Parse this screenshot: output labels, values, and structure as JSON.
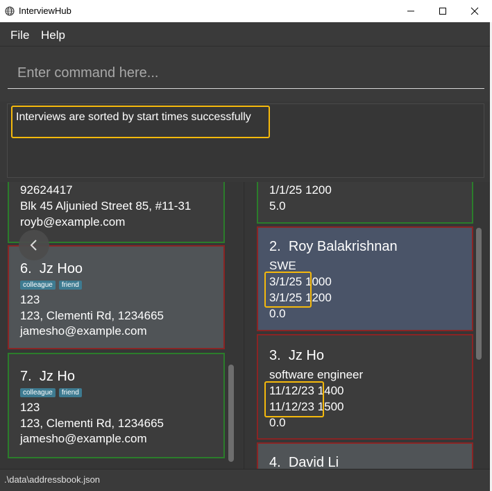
{
  "window": {
    "title": "InterviewHub"
  },
  "menu": {
    "file": "File",
    "help": "Help"
  },
  "command": {
    "placeholder": "Enter command here...",
    "value": ""
  },
  "result": {
    "message": "Interviews are sorted by start times successfully"
  },
  "persons": [
    {
      "phone": "92624417",
      "address": "Blk 45 Aljunied Street 85, #11-31",
      "email": "royb@example.com"
    },
    {
      "index": "6.",
      "name": "Jz Hoo",
      "tags": [
        "colleague",
        "friend"
      ],
      "phone": "123",
      "address": "123, Clementi Rd, 1234665",
      "email": "jamesho@example.com"
    },
    {
      "index": "7.",
      "name": "Jz Ho",
      "tags": [
        "colleague",
        "friend"
      ],
      "phone": "123",
      "address": "123, Clementi Rd, 1234665",
      "email": "jamesho@example.com"
    }
  ],
  "interviews": [
    {
      "start": "1/1/25 1200",
      "rating": "5.0"
    },
    {
      "index": "2.",
      "name": "Roy Balakrishnan",
      "role": "SWE",
      "start_date": "3/1/25",
      "start_time": "1000",
      "end_date": "3/1/25",
      "end_time": "1200",
      "rating": "0.0"
    },
    {
      "index": "3.",
      "name": "Jz Ho",
      "role": "software engineer",
      "start_date": "11/12/23",
      "start_time": "1400",
      "end_date": "11/12/23",
      "end_time": "1500",
      "rating": "0.0"
    },
    {
      "index": "4.",
      "name": "David Li"
    }
  ],
  "status": {
    "path": ".\\data\\addressbook.json"
  },
  "colors": {
    "highlight": "#f5b90c",
    "tag": "#3e7b91",
    "green_border": "#2b7d2b",
    "red_border": "#8a2424"
  },
  "icons": {
    "app": "globe-icon",
    "back": "chevron-left-icon"
  }
}
